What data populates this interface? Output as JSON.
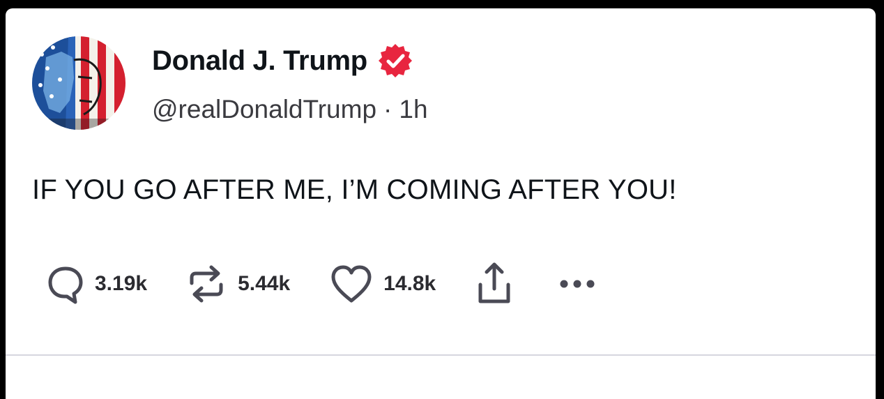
{
  "post": {
    "author": {
      "display_name": "Donald J. Trump",
      "handle": "@realDonaldTrump",
      "verified_color": "#e8253f",
      "avatar_icon": "flag-portrait-avatar"
    },
    "time_separator": "·",
    "time_ago": "1h",
    "text": "IF YOU GO AFTER ME, I’M COMING AFTER YOU!",
    "actions": {
      "replies": {
        "icon": "reply-bubble-icon",
        "count": "3.19k"
      },
      "reposts": {
        "icon": "repost-arrows-icon",
        "count": "5.44k"
      },
      "likes": {
        "icon": "heart-icon",
        "count": "14.8k"
      },
      "share": {
        "icon": "share-icon"
      },
      "more": {
        "icon": "more-dots-icon"
      }
    }
  },
  "colors": {
    "text_primary": "#0f1419",
    "text_secondary": "#3a3a3f",
    "icon_color": "#4a4a55",
    "frame_background": "#000000"
  }
}
